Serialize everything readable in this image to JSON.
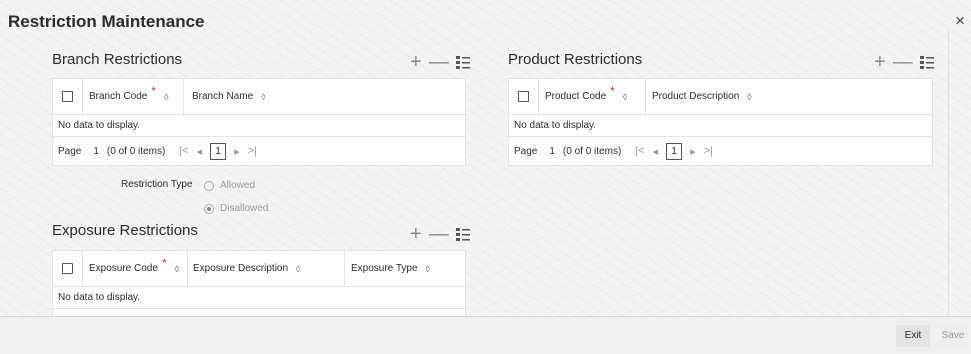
{
  "window": {
    "title": "Restriction Maintenance",
    "close_symbol": "×"
  },
  "branch": {
    "title": "Branch Restrictions",
    "columns": [
      "Branch Code",
      "Branch Name"
    ],
    "no_data": "No data to display.",
    "pager": {
      "page_label": "Page",
      "page_value": "1",
      "items": "(0 of 0 items)",
      "current": "1"
    }
  },
  "restriction_type": {
    "label": "Restriction Type",
    "options": [
      "Allowed",
      "Disallowed"
    ],
    "selected": "Disallowed"
  },
  "product": {
    "title": "Product Restrictions",
    "columns": [
      "Product Code",
      "Product Description"
    ],
    "no_data": "No data to display.",
    "pager": {
      "page_label": "Page",
      "page_value": "1",
      "items": "(0 of 0 items)",
      "current": "1"
    }
  },
  "exposure": {
    "title": "Exposure Restrictions",
    "columns": [
      "Exposure Code",
      "Exposure Description",
      "Exposure Type"
    ],
    "no_data": "No data to display."
  },
  "actions": {
    "add": "+",
    "remove": "—"
  },
  "pager_nav": {
    "first": "|<",
    "prev": "◂",
    "next": "▸",
    "last": ">|"
  },
  "footer": {
    "exit": "Exit",
    "save": "Save"
  },
  "required_mark": "*",
  "sort_glyph": "◊"
}
